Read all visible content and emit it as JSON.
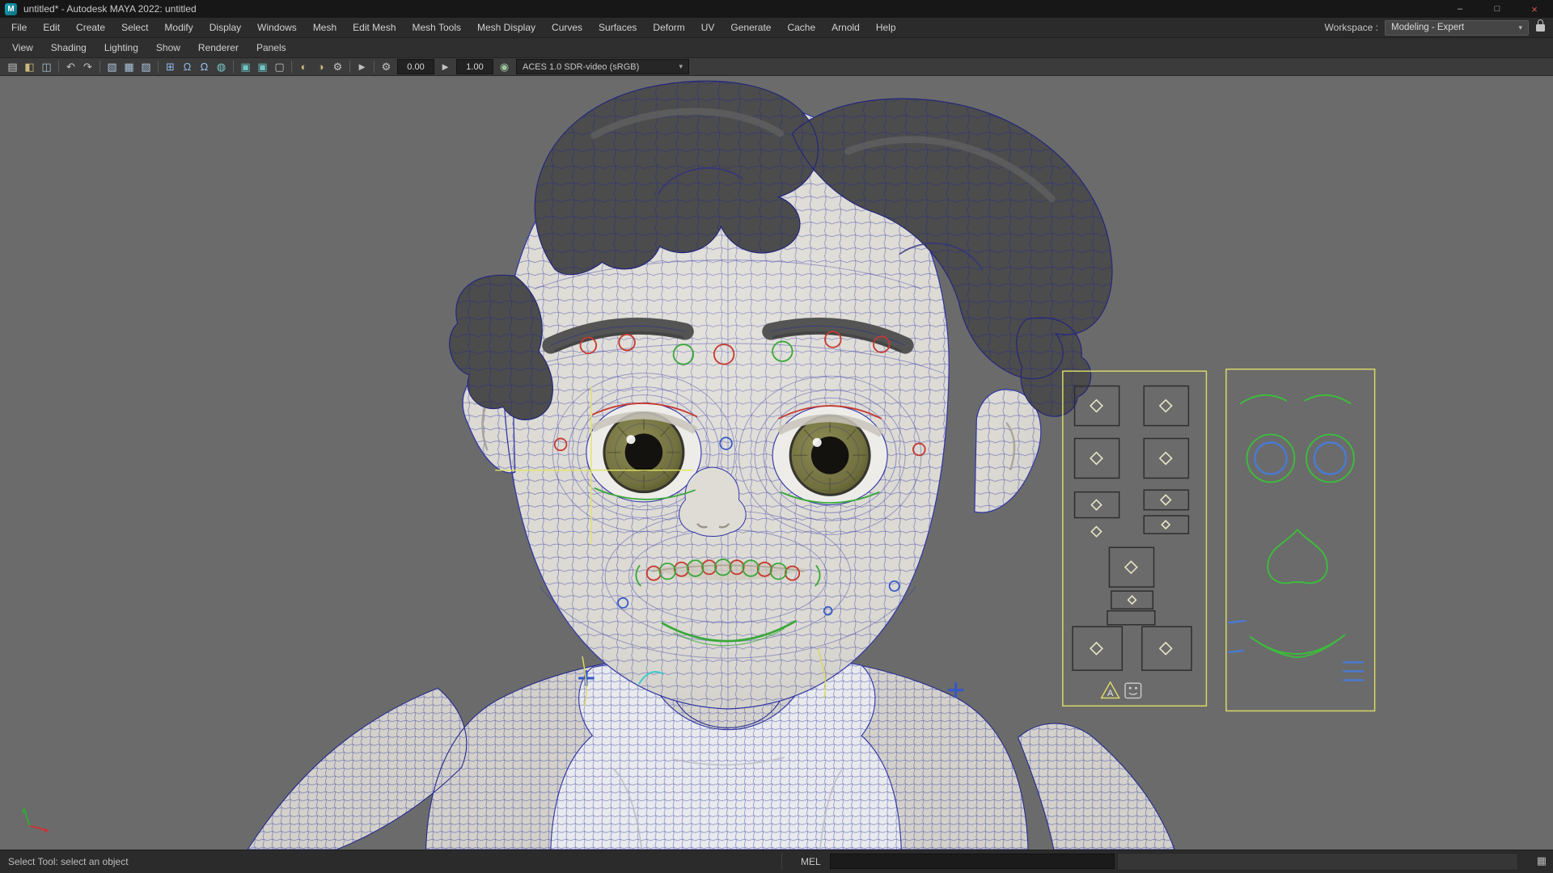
{
  "window": {
    "title": "untitled* - Autodesk MAYA 2022: untitled",
    "logo_letter": "M",
    "minimize_glyph": "–",
    "maximize_glyph": "□",
    "close_glyph": "×"
  },
  "menu_bar": {
    "items": [
      "File",
      "Edit",
      "Create",
      "Select",
      "Modify",
      "Display",
      "Windows",
      "Mesh",
      "Edit Mesh",
      "Mesh Tools",
      "Mesh Display",
      "Curves",
      "Surfaces",
      "Deform",
      "UV",
      "Generate",
      "Cache",
      "Arnold",
      "Help"
    ],
    "workspace_label": "Workspace :",
    "workspace_value": "Modeling - Expert",
    "workspace_chevron": "▾"
  },
  "panel_menu": {
    "items": [
      "View",
      "Shading",
      "Lighting",
      "Show",
      "Renderer",
      "Panels"
    ]
  },
  "toolbar": {
    "field_translate": "0.00",
    "field_scale": "1.00",
    "colorspace": "ACES 1.0 SDR-video (sRGB)",
    "colorspace_chevron": "▾",
    "icons": [
      {
        "name": "new-scene-icon",
        "glyph": "▤",
        "color": "#c2c2c2"
      },
      {
        "name": "open-scene-icon",
        "glyph": "◧",
        "color": "#cdb97c"
      },
      {
        "name": "save-scene-icon",
        "glyph": "◫",
        "color": "#a9bdd0"
      },
      {
        "name": "undo-icon",
        "glyph": "↶",
        "color": "#c2c2c2"
      },
      {
        "name": "redo-icon",
        "glyph": "↷",
        "color": "#c2c2c2"
      },
      {
        "name": "select-hierarchy-icon",
        "glyph": "▧",
        "color": "#aac2da"
      },
      {
        "name": "select-object-icon",
        "glyph": "▦",
        "color": "#aac2da"
      },
      {
        "name": "select-component-icon",
        "glyph": "▨",
        "color": "#aac2da"
      },
      {
        "name": "snap-to-grid-icon",
        "glyph": "⊞",
        "color": "#8fb7e8"
      },
      {
        "name": "snap-to-curve-icon",
        "glyph": "Ω",
        "color": "#8fb7e8"
      },
      {
        "name": "snap-to-point-icon",
        "glyph": "Ω",
        "color": "#9fc3ec"
      },
      {
        "name": "make-live-icon",
        "glyph": "◍",
        "color": "#7ac8c8"
      },
      {
        "name": "input-connections-icon",
        "glyph": "▣",
        "color": "#6fc6c6"
      },
      {
        "name": "output-connections-icon",
        "glyph": "▣",
        "color": "#6fc6c6"
      },
      {
        "name": "construction-history-icon",
        "glyph": "▢",
        "color": "#c2c2c2"
      },
      {
        "name": "render-view-icon",
        "glyph": "◐",
        "color": "#cdb97c"
      },
      {
        "name": "ipr-render-icon",
        "glyph": "◑",
        "color": "#cdb97c"
      },
      {
        "name": "render-settings-icon",
        "glyph": "⚙",
        "color": "#c2c2c2"
      },
      {
        "name": "absolute-transform-icon",
        "glyph": "►",
        "color": "#c2c2c2"
      },
      {
        "name": "soft-select-icon",
        "glyph": "⚙",
        "color": "#c2c2c2"
      },
      {
        "name": "step-icon",
        "glyph": "►",
        "color": "#c2c2c2"
      },
      {
        "name": "colorspace-globe-icon",
        "glyph": "◉",
        "color": "#9ec49e"
      }
    ]
  },
  "viewport": {
    "board_a_label": "A"
  },
  "status_bar": {
    "help_text": "Select Tool: select an object",
    "mel_label": "MEL",
    "mel_value": ""
  }
}
